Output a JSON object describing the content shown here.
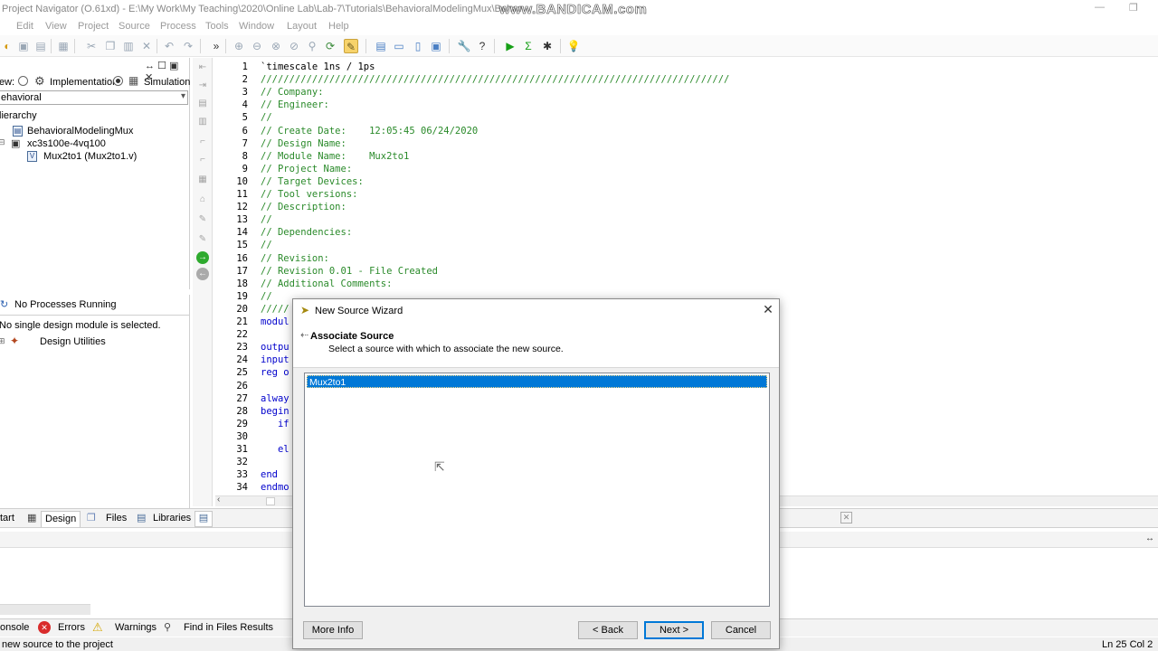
{
  "window": {
    "title": "Project Navigator (O.61xd) - E:\\My Work\\My Teaching\\2020\\Online Lab\\Lab-7\\Tutorials\\BehavioralModelingMux\\Behav",
    "watermark": "www.BANDICAM.com"
  },
  "menu": [
    "Edit",
    "View",
    "Project",
    "Source",
    "Process",
    "Tools",
    "Window",
    "Layout",
    "Help"
  ],
  "design_panel": {
    "view_label": "ew:",
    "implementation_label": "Implementation",
    "simulation_label": "Simulation",
    "simulation_selected": true,
    "view_select_value": "ehavioral",
    "hierarchy_label": "lierarchy",
    "tree": [
      {
        "label": "BehavioralModelingMux"
      },
      {
        "label": "xc3s100e-4vq100"
      },
      {
        "label": "Mux2to1 (Mux2to1.v)"
      }
    ]
  },
  "processes_panel": {
    "status": "No Processes Running",
    "message": "No single design module is selected.",
    "utilities_label": "Design Utilities"
  },
  "editor": {
    "lines": [
      {
        "n": "1",
        "text": "`timescale 1ns / 1ps",
        "cls": "plain"
      },
      {
        "n": "2",
        "text": "//////////////////////////////////////////////////////////////////////////////////",
        "cls": "comment"
      },
      {
        "n": "3",
        "text": "// Company:",
        "cls": "comment"
      },
      {
        "n": "4",
        "text": "// Engineer:",
        "cls": "comment"
      },
      {
        "n": "5",
        "text": "//",
        "cls": "comment"
      },
      {
        "n": "6",
        "text": "// Create Date:    12:05:45 06/24/2020",
        "cls": "comment"
      },
      {
        "n": "7",
        "text": "// Design Name:",
        "cls": "comment"
      },
      {
        "n": "8",
        "text": "// Module Name:    Mux2to1",
        "cls": "comment"
      },
      {
        "n": "9",
        "text": "// Project Name:",
        "cls": "comment"
      },
      {
        "n": "10",
        "text": "// Target Devices:",
        "cls": "comment"
      },
      {
        "n": "11",
        "text": "// Tool versions:",
        "cls": "comment"
      },
      {
        "n": "12",
        "text": "// Description:",
        "cls": "comment"
      },
      {
        "n": "13",
        "text": "//",
        "cls": "comment"
      },
      {
        "n": "14",
        "text": "// Dependencies:",
        "cls": "comment"
      },
      {
        "n": "15",
        "text": "//",
        "cls": "comment"
      },
      {
        "n": "16",
        "text": "// Revision:",
        "cls": "comment"
      },
      {
        "n": "17",
        "text": "// Revision 0.01 - File Created",
        "cls": "comment"
      },
      {
        "n": "18",
        "text": "// Additional Comments:",
        "cls": "comment"
      },
      {
        "n": "19",
        "text": "//",
        "cls": "comment"
      },
      {
        "n": "20",
        "text": "/////",
        "cls": "comment"
      },
      {
        "n": "21",
        "text": "modul",
        "cls": "kw"
      },
      {
        "n": "22",
        "text": "",
        "cls": "plain"
      },
      {
        "n": "23",
        "text": "outpu",
        "cls": "kw"
      },
      {
        "n": "24",
        "text": "input",
        "cls": "kw"
      },
      {
        "n": "25",
        "text": "reg o",
        "cls": "kw"
      },
      {
        "n": "26",
        "text": "",
        "cls": "plain"
      },
      {
        "n": "27",
        "text": "alway",
        "cls": "kw"
      },
      {
        "n": "28",
        "text": "begin",
        "cls": "kw"
      },
      {
        "n": "29",
        "text": "   if",
        "cls": "kw"
      },
      {
        "n": "30",
        "text": "",
        "cls": "plain"
      },
      {
        "n": "31",
        "text": "   el",
        "cls": "kw"
      },
      {
        "n": "32",
        "text": "",
        "cls": "plain"
      },
      {
        "n": "33",
        "text": "end",
        "cls": "kw"
      },
      {
        "n": "34",
        "text": "endmo",
        "cls": "kw"
      }
    ]
  },
  "bottom_tabs": {
    "start": "tart",
    "design": "Design",
    "files": "Files",
    "libraries": "Libraries"
  },
  "console_tabs": {
    "console": "onsole",
    "errors": "Errors",
    "warnings": "Warnings",
    "find": "Find in Files Results"
  },
  "status": {
    "left": "new source to the project",
    "right": "Ln 25 Col 2"
  },
  "dialog": {
    "title": "New Source Wizard",
    "heading": "Associate Source",
    "subheading": "Select a source with which to associate the new source.",
    "list_items": [
      "Mux2to1"
    ],
    "more_info": "More Info",
    "back": "< Back",
    "next": "Next >",
    "cancel": "Cancel"
  }
}
